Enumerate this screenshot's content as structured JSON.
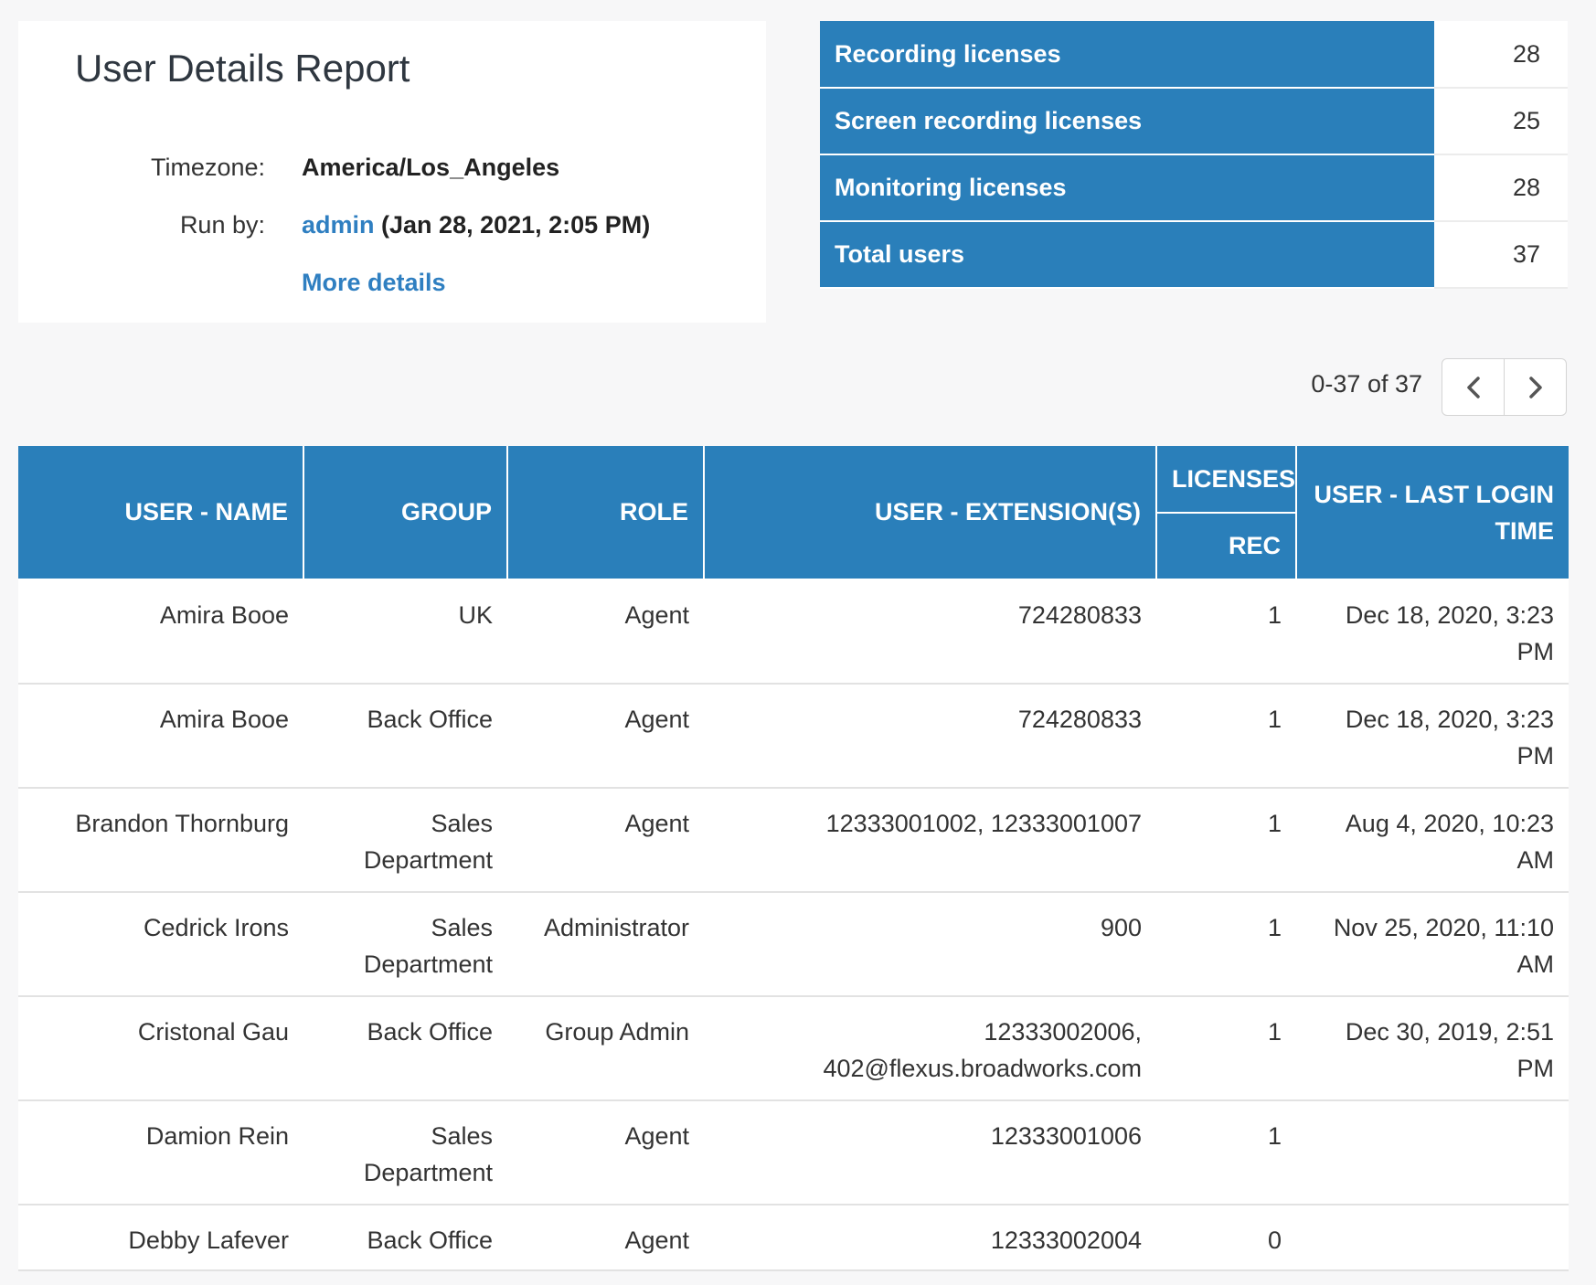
{
  "report": {
    "title": "User Details Report",
    "timezone_label": "Timezone:",
    "timezone_value": "America/Los_Angeles",
    "run_by_label": "Run by:",
    "run_by_user": "admin",
    "run_by_time": "(Jan 28, 2021, 2:05 PM)",
    "more_details": "More details"
  },
  "stats": [
    {
      "label": "Recording licenses",
      "value": "28"
    },
    {
      "label": "Screen recording licenses",
      "value": "25"
    },
    {
      "label": "Monitoring licenses",
      "value": "28"
    },
    {
      "label": "Total users",
      "value": "37"
    }
  ],
  "pagination": {
    "text": "0-37 of 37",
    "prev_icon": "chevron-left-icon",
    "next_icon": "chevron-right-icon"
  },
  "table": {
    "headers": {
      "name": "USER - NAME",
      "group": "GROUP",
      "role": "ROLE",
      "extension": "USER - EXTENSION(S)",
      "licenses": "LICENSES",
      "rec": "REC",
      "last_login": "USER - LAST LOGIN TIME"
    },
    "rows": [
      {
        "name": "Amira Booe",
        "group": "UK",
        "role": "Agent",
        "extension": "724280833",
        "rec": "1",
        "last_login": "Dec 18, 2020, 3:23 PM"
      },
      {
        "name": "Amira Booe",
        "group": "Back Office",
        "role": "Agent",
        "extension": "724280833",
        "rec": "1",
        "last_login": "Dec 18, 2020, 3:23 PM"
      },
      {
        "name": "Brandon Thornburg",
        "group": "Sales Department",
        "role": "Agent",
        "extension": "12333001002, 12333001007",
        "rec": "1",
        "last_login": "Aug 4, 2020, 10:23 AM"
      },
      {
        "name": "Cedrick Irons",
        "group": "Sales Department",
        "role": "Administrator",
        "extension": "900",
        "rec": "1",
        "last_login": "Nov 25, 2020, 11:10 AM"
      },
      {
        "name": "Cristonal Gau",
        "group": "Back Office",
        "role": "Group Admin",
        "extension": "12333002006, 402@flexus.broadworks.com",
        "rec": "1",
        "last_login": "Dec 30, 2019, 2:51 PM"
      },
      {
        "name": "Damion Rein",
        "group": "Sales Department",
        "role": "Agent",
        "extension": "12333001006",
        "rec": "1",
        "last_login": ""
      },
      {
        "name": "Debby Lafever",
        "group": "Back Office",
        "role": "Agent",
        "extension": "12333002004",
        "rec": "0",
        "last_login": ""
      }
    ]
  }
}
